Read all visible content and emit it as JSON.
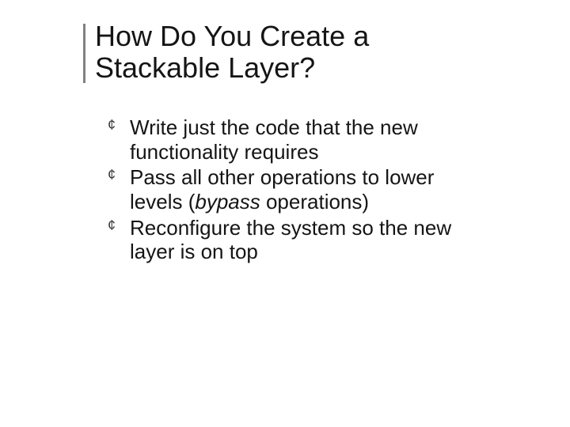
{
  "slide": {
    "title": "How Do You Create a Stackable Layer?",
    "bullets": [
      {
        "pre": "Write just the code that the new functionality requires",
        "em": "",
        "post": ""
      },
      {
        "pre": "Pass all other operations to lower levels (",
        "em": "bypass",
        "post": " operations)"
      },
      {
        "pre": "Reconfigure the system so the new layer is on top",
        "em": "",
        "post": ""
      }
    ]
  }
}
